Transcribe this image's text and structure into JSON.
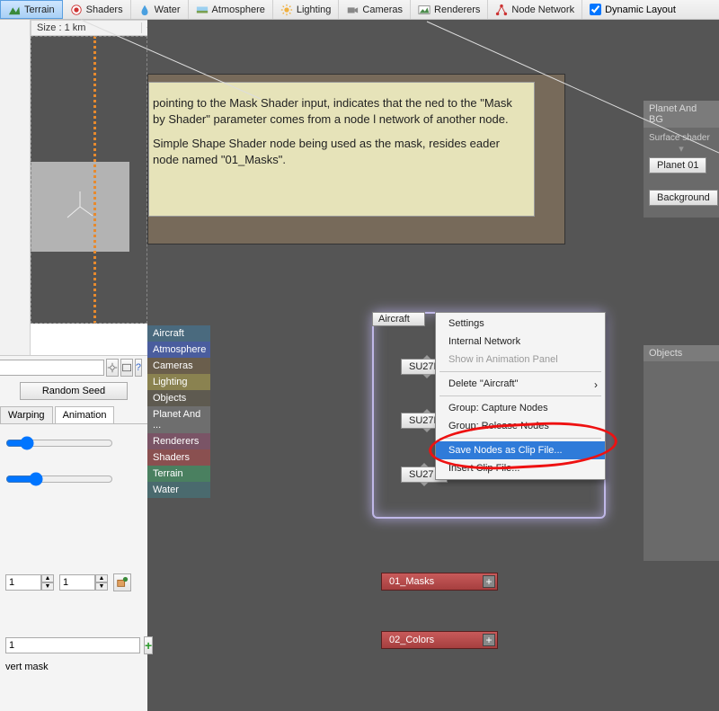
{
  "toolbar": {
    "terrain": "Terrain",
    "shaders": "Shaders",
    "water": "Water",
    "atmosphere": "Atmosphere",
    "lighting": "Lighting",
    "cameras": "Cameras",
    "renderers": "Renderers",
    "node_network": "Node Network",
    "dynamic_layout": "Dynamic Layout"
  },
  "sizebar": {
    "label": "Size : 1 km",
    "plus": "+",
    "minus": "-"
  },
  "tooltip": {
    "p1": "pointing to the Mask Shader input, indicates that the ned to the \"Mask by Shader\" parameter comes from a node l network of another node.",
    "p2": "Simple Shape Shader node being used as the mask, resides eader node named \"01_Masks\"."
  },
  "categories": [
    "Aircraft",
    "Atmosphere",
    "Cameras",
    "Lighting",
    "Objects",
    "Planet And ...",
    "Renderers",
    "Shaders",
    "Terrain",
    "Water"
  ],
  "group": {
    "title": "Aircraft",
    "nodes": [
      "SU27F",
      "SU27F",
      "SU27"
    ]
  },
  "header_nodes": [
    "01_Masks",
    "02_Colors"
  ],
  "context_menu": {
    "settings": "Settings",
    "internal_network": "Internal Network",
    "show_anim": "Show in Animation Panel",
    "delete": "Delete \"Aircraft\"",
    "group_capture": "Group: Capture Nodes",
    "group_release": "Group: Release Nodes",
    "save_clip": "Save Nodes as Clip File...",
    "insert_clip": "Insert Clip File..."
  },
  "right_panels": {
    "planet": {
      "title": "Planet And BG",
      "surface_lbl": "Surface shader",
      "planet_btn": "Planet 01",
      "background_btn": "Background"
    },
    "objects": {
      "title": "Objects"
    }
  },
  "settings": {
    "random_seed": "Random Seed",
    "tab_warping": "Warping",
    "tab_animation": "Animation",
    "spin1": "1",
    "spin2": "1",
    "field1": "1",
    "invert_mask": "vert mask"
  }
}
